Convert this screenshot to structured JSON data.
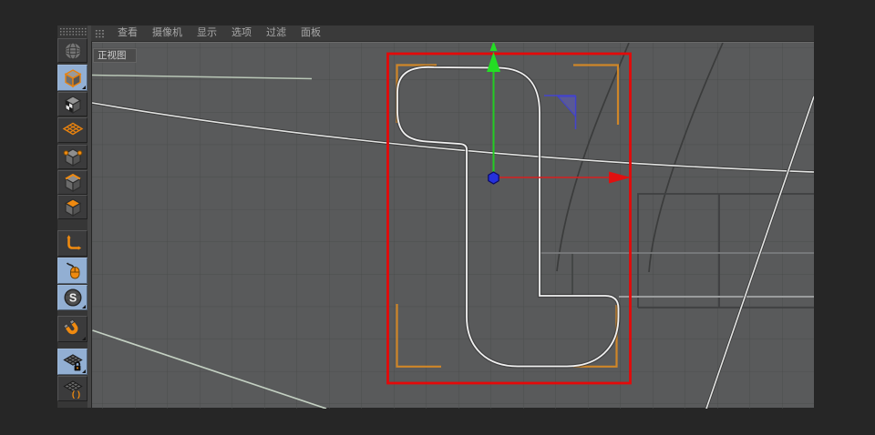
{
  "menubar": {
    "items": [
      "查看",
      "摄像机",
      "显示",
      "选项",
      "过滤",
      "面板"
    ]
  },
  "viewport": {
    "label": "正视图"
  },
  "toolbar": {
    "items": [
      {
        "name": "render-view",
        "icon": "globe-icon",
        "selected": false
      },
      {
        "name": "model-mode",
        "icon": "cube-icon",
        "selected": true
      },
      {
        "name": "texture-mode",
        "icon": "checkered-cube-icon",
        "selected": false
      },
      {
        "name": "workplane-mode",
        "icon": "orange-grid-icon",
        "selected": false
      },
      {
        "name": "points-mode",
        "icon": "cube-points-icon",
        "selected": false
      },
      {
        "name": "edges-mode",
        "icon": "cube-edges-icon",
        "selected": false
      },
      {
        "name": "polygons-mode",
        "icon": "cube-face-icon",
        "selected": false
      },
      {
        "name": "enable-axis",
        "icon": "axis-corner-icon",
        "selected": false
      },
      {
        "name": "tweak-mode",
        "icon": "mouse-icon",
        "selected": true
      },
      {
        "name": "snap-settings",
        "icon": "s-badge-icon",
        "selected": true
      },
      {
        "name": "snapping",
        "icon": "magnet-icon",
        "selected": false
      },
      {
        "name": "workplane-lock",
        "icon": "grid-lock-icon",
        "selected": true
      },
      {
        "name": "planar-workplane",
        "icon": "grid-paren-icon",
        "selected": false
      }
    ]
  },
  "scene": {
    "selection_box_color": "#e40909",
    "bracket_color": "#cf8628",
    "axis_x_color": "#e02020",
    "axis_y_color": "#22cc22",
    "plane_handle_color": "#4545cc",
    "origin_color": "#2531dd",
    "spline_color": "#f1f1f1",
    "grid_color": "#4c4d4d",
    "background_color": "#595a5b"
  }
}
